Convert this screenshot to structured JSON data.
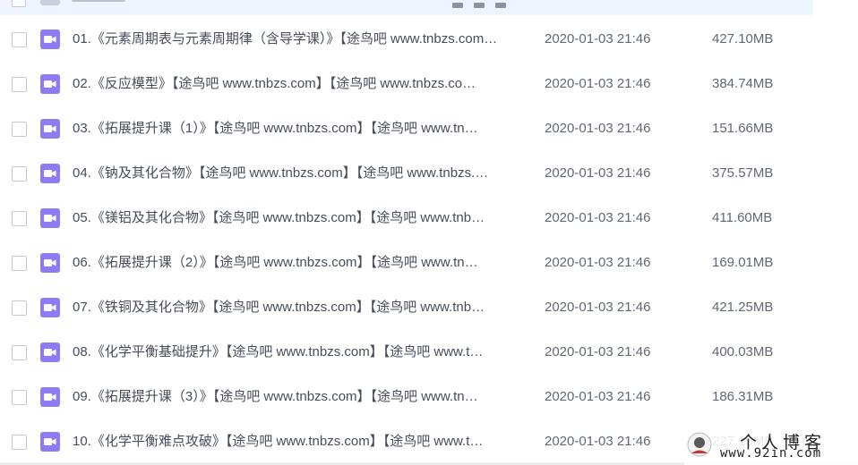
{
  "colors": {
    "file_icon": "#8c7bf4",
    "header_bg": "#eef5ff",
    "text": "#454d5a",
    "meta_text": "#606874"
  },
  "icons": {
    "row_icon": "video-file-icon",
    "select": "checkbox-icon"
  },
  "files": [
    {
      "name": "01.《元素周期表与元素周期律（含导学课）》【途鸟吧 www.tnbzs.com…",
      "date": "2020-01-03 21:46",
      "size": "427.10MB"
    },
    {
      "name": "02.《反应模型》【途鸟吧 www.tnbzs.com】【途鸟吧 www.tnbzs.co…",
      "date": "2020-01-03 21:46",
      "size": "384.74MB"
    },
    {
      "name": "03.《拓展提升课（1）》【途鸟吧 www.tnbzs.com】【途鸟吧 www.tn…",
      "date": "2020-01-03 21:46",
      "size": "151.66MB"
    },
    {
      "name": "04.《钠及其化合物》【途鸟吧 www.tnbzs.com】【途鸟吧 www.tnbzs.…",
      "date": "2020-01-03 21:46",
      "size": "375.57MB"
    },
    {
      "name": "05.《镁铝及其化合物》【途鸟吧 www.tnbzs.com】【途鸟吧 www.tnb…",
      "date": "2020-01-03 21:46",
      "size": "411.60MB"
    },
    {
      "name": "06.《拓展提升课（2）》【途鸟吧 www.tnbzs.com】【途鸟吧 www.tn…",
      "date": "2020-01-03 21:46",
      "size": "169.01MB"
    },
    {
      "name": "07.《铁铜及其化合物》【途鸟吧 www.tnbzs.com】【途鸟吧 www.tnb…",
      "date": "2020-01-03 21:46",
      "size": "421.25MB"
    },
    {
      "name": "08.《化学平衡基础提升》【途鸟吧 www.tnbzs.com】【途鸟吧 www.t…",
      "date": "2020-01-03 21:46",
      "size": "400.03MB"
    },
    {
      "name": "09.《拓展提升课（3）》【途鸟吧 www.tnbzs.com】【途鸟吧 www.tn…",
      "date": "2020-01-03 21:46",
      "size": "186.31MB"
    },
    {
      "name": "10.《化学平衡难点攻破》【途鸟吧 www.tnbzs.com】【途鸟吧 www.t…",
      "date": "2020-01-03 21:46",
      "size": "227.10MB"
    }
  ],
  "watermark": {
    "title": "个人博客",
    "url": "www.92in.com"
  }
}
